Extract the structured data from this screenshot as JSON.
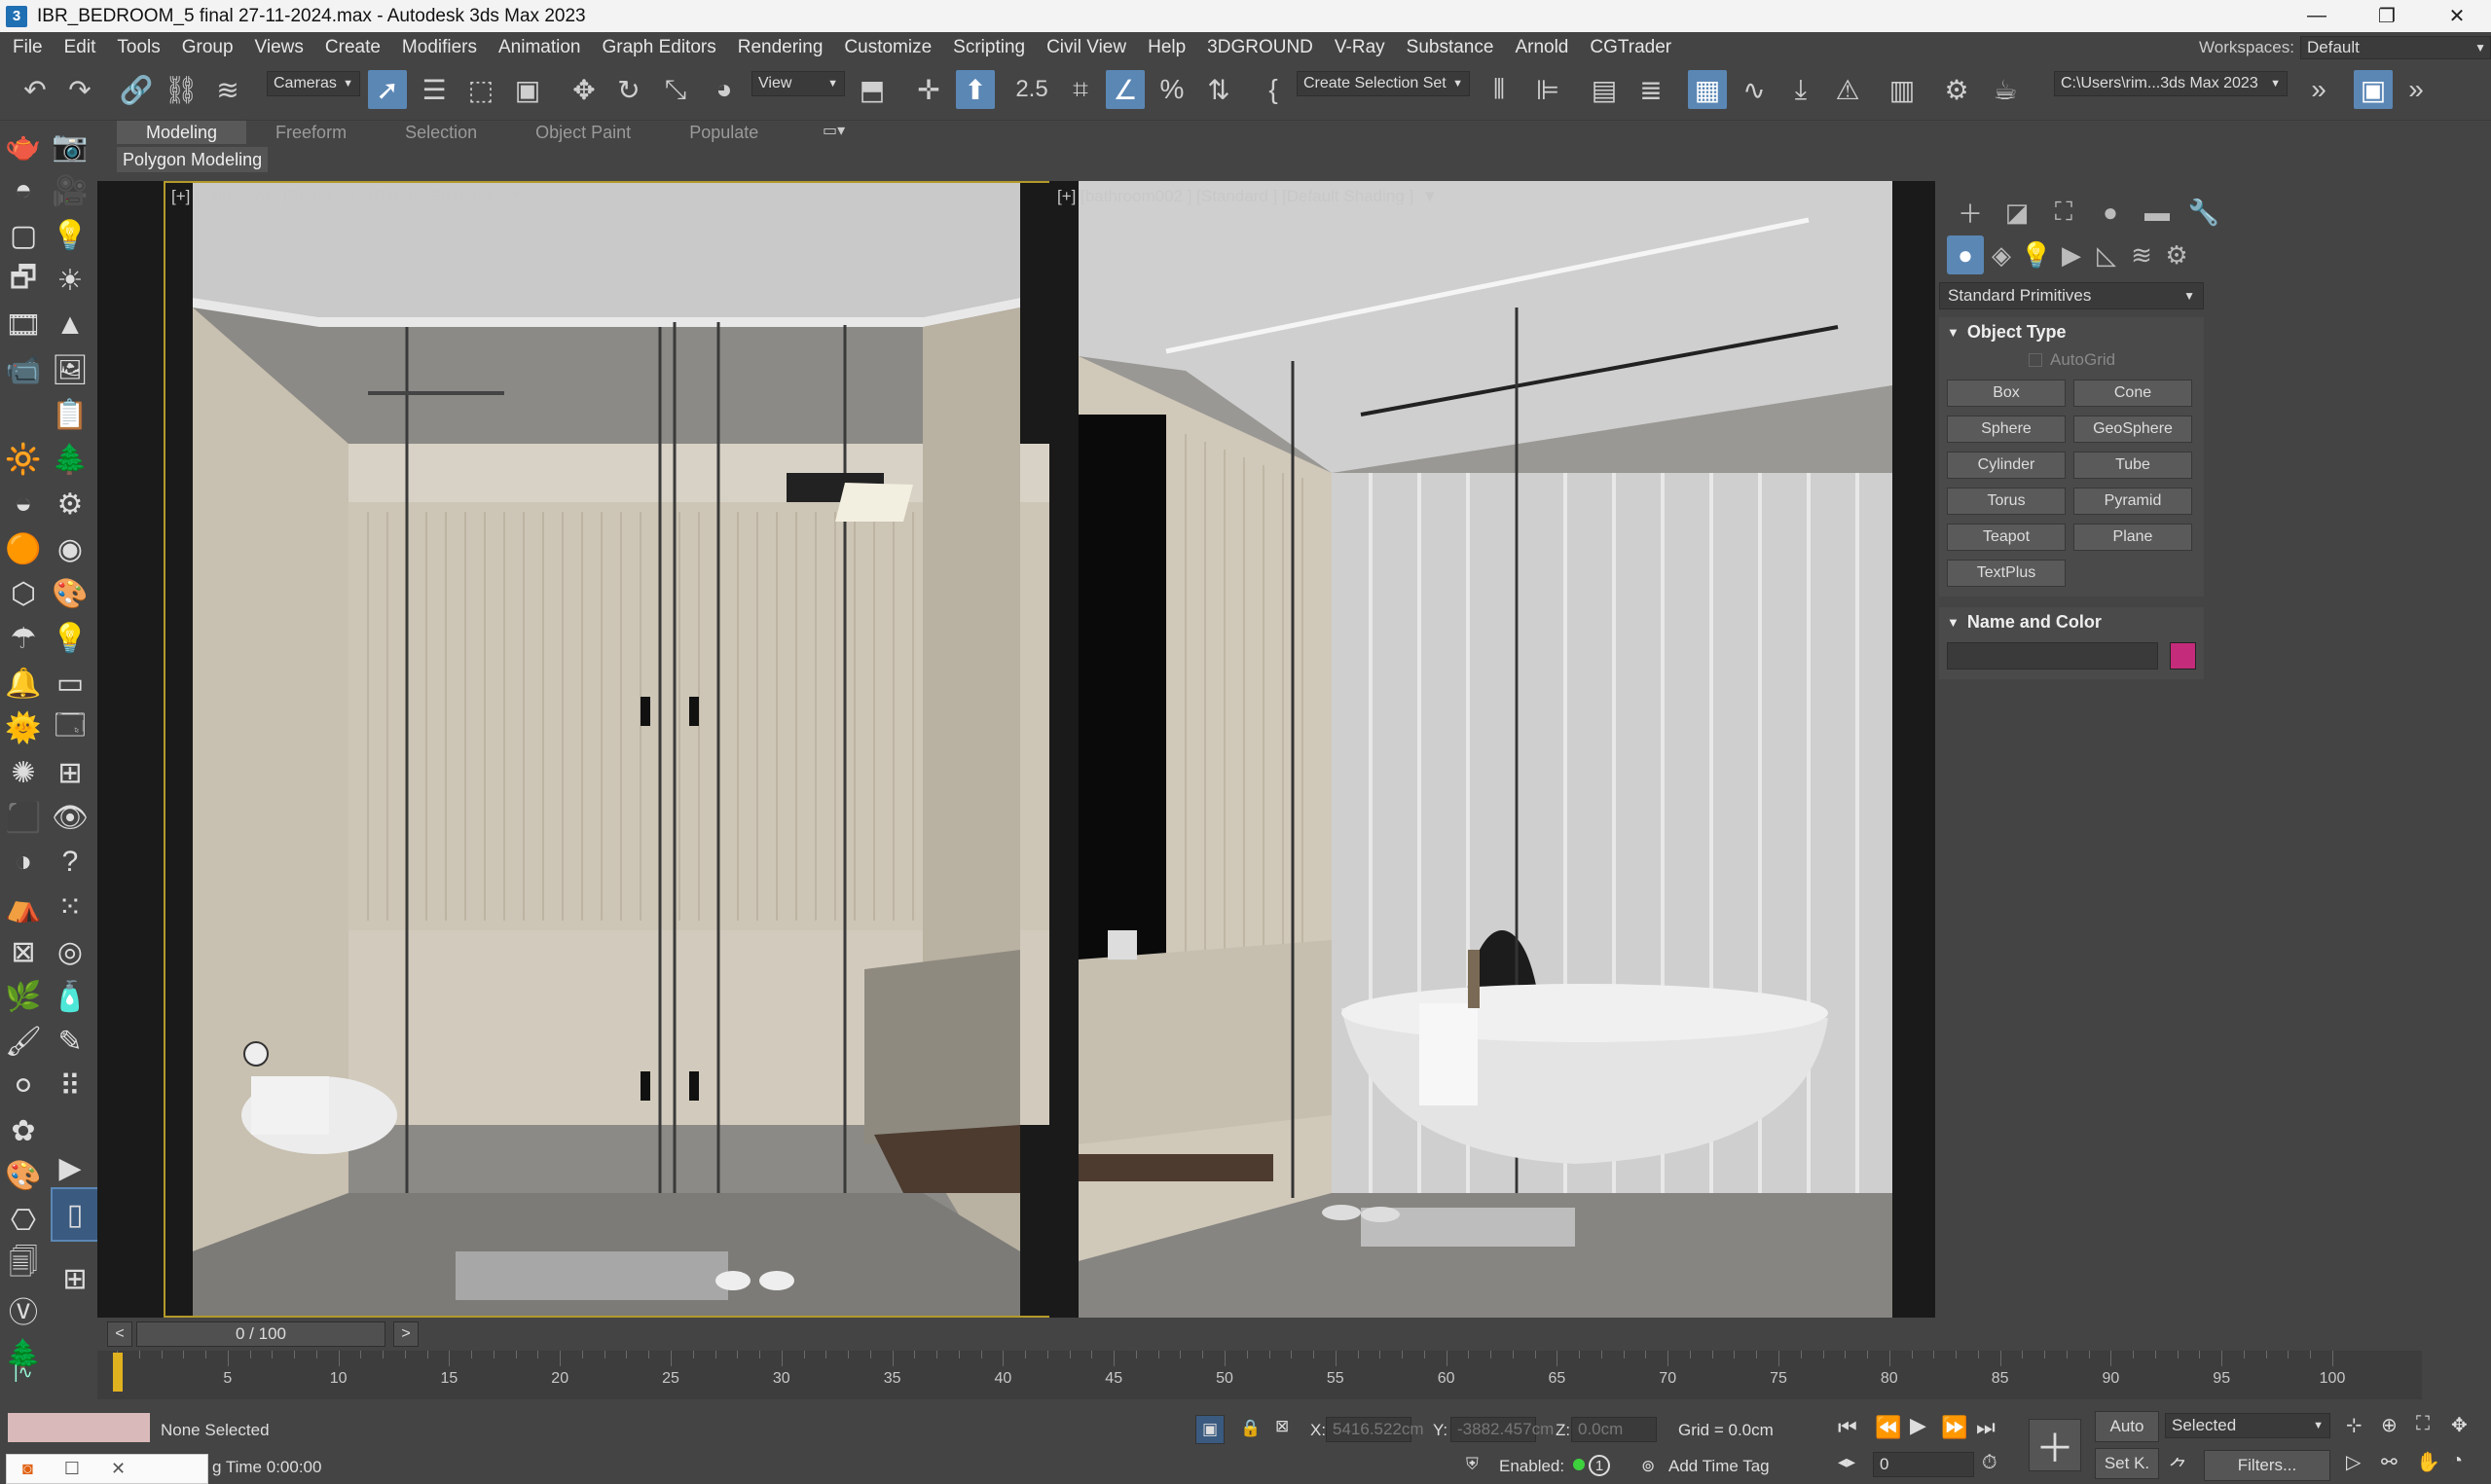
{
  "window": {
    "title": "IBR_BEDROOM_5 final 27-11-2024.max - Autodesk 3ds Max 2023",
    "app_icon": "3"
  },
  "menu": [
    "File",
    "Edit",
    "Tools",
    "Group",
    "Views",
    "Create",
    "Modifiers",
    "Animation",
    "Graph Editors",
    "Rendering",
    "Customize",
    "Scripting",
    "Civil View",
    "Help",
    "3DGROUND",
    "V-Ray",
    "Substance",
    "Arnold",
    "CGTrader"
  ],
  "workspace": {
    "label": "Workspaces:",
    "value": "Default"
  },
  "toolbar": {
    "selection_filter": "Cameras",
    "ref_coord": "View",
    "snap_value": "2.5",
    "named_selection": "Create Selection Set",
    "project_path": "C:\\Users\\rim...3ds Max 2023"
  },
  "ribbon": {
    "tabs": [
      "Modeling",
      "Freeform",
      "Selection",
      "Object Paint",
      "Populate"
    ],
    "active_tab": "Modeling",
    "sub_label": "Polygon Modeling"
  },
  "viewports": [
    {
      "label": "[+] [bathroom ] [Standard ] [Default Shading ]"
    },
    {
      "label": "[+] [bathroom002 ] [Standard ] [Default Shading ]"
    }
  ],
  "command_panel": {
    "category_dropdown": "Standard Primitives",
    "object_type_title": "Object Type",
    "autogrid_label": "AutoGrid",
    "primitives": [
      "Box",
      "Cone",
      "Sphere",
      "GeoSphere",
      "Cylinder",
      "Tube",
      "Torus",
      "Pyramid",
      "Teapot",
      "Plane",
      "TextPlus"
    ],
    "name_color_title": "Name and Color",
    "object_color": "#c42b7a"
  },
  "timeline": {
    "frame_display": "0 / 100",
    "prev": "<",
    "next": ">",
    "current_frame": 0,
    "max_frame": 100,
    "tick_labels": [
      "0",
      "5",
      "10",
      "15",
      "20",
      "25",
      "30",
      "35",
      "40",
      "45",
      "50",
      "55",
      "60",
      "65",
      "70",
      "75",
      "80",
      "85",
      "90",
      "95",
      "100"
    ]
  },
  "status": {
    "selection": "None Selected",
    "time_text": "g Time  0:00:00",
    "x_label": "X:",
    "x_value": "5416.522cm",
    "y_label": "Y:",
    "y_value": "-3882.457cm",
    "z_label": "Z:",
    "z_value": "0.0cm",
    "grid": "Grid = 0.0cm",
    "enabled_label": "Enabled:",
    "enabled_count": "1",
    "add_time_tag": "Add Time Tag",
    "auto_key": "Auto",
    "set_key": "Set K.",
    "key_mode": "Selected",
    "filters": "Filters...",
    "frame_field": "0"
  },
  "colors": {
    "accent": "#5b87b5",
    "viewport_border": "#b39a2a",
    "time_cursor": "#e1b21f"
  }
}
